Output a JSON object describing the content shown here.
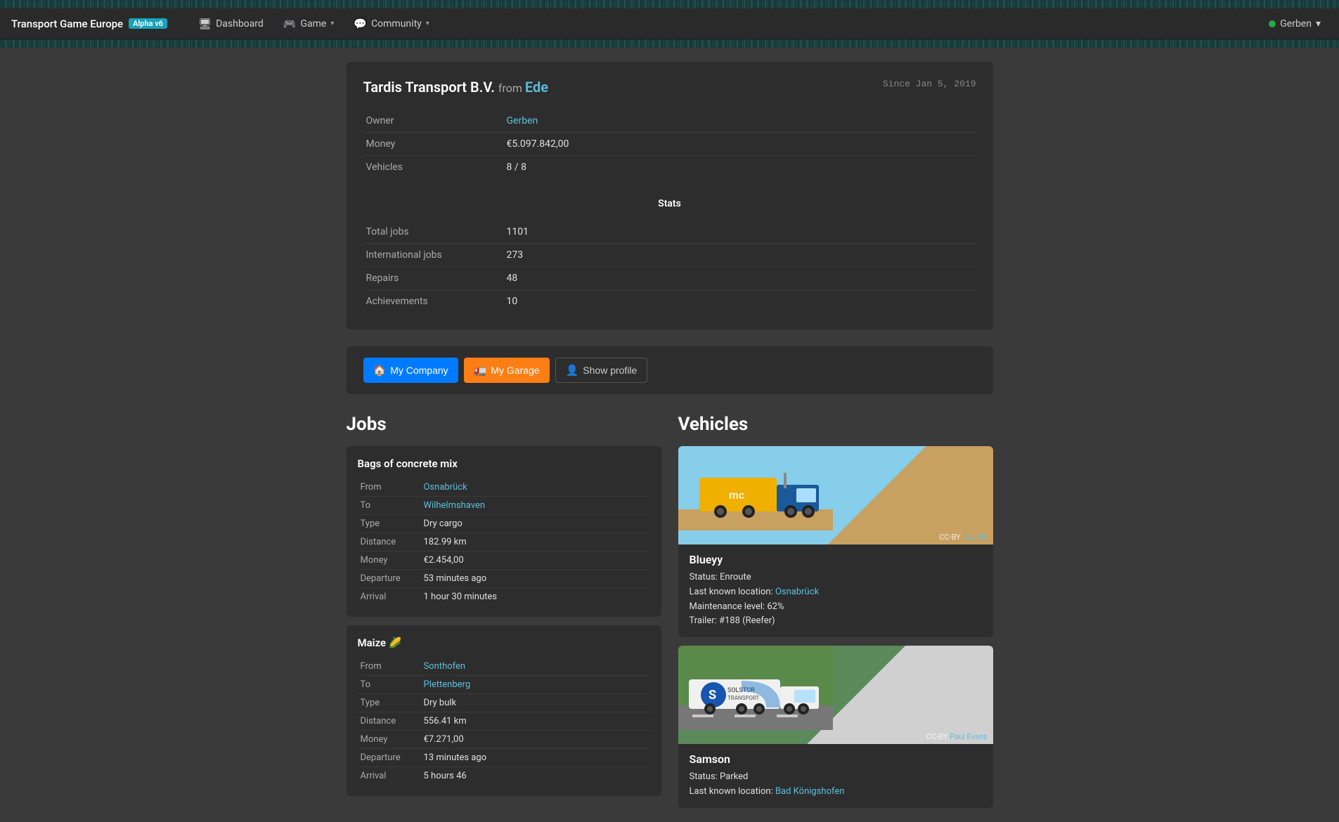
{
  "navbar": {
    "brand_title": "Transport Game Europe",
    "badge": "Alpha v6",
    "nav_items": [
      {
        "label": "Dashboard",
        "icon": "🖥",
        "has_dropdown": false
      },
      {
        "label": "Game",
        "icon": "🎮",
        "has_dropdown": true
      },
      {
        "label": "Community",
        "icon": "💬",
        "has_dropdown": true
      }
    ],
    "user": {
      "name": "Gerben",
      "status_color": "#28a745",
      "has_dropdown": true
    }
  },
  "company": {
    "name": "Tardis Transport B.V.",
    "from_label": "from",
    "city": "Ede",
    "since": "Since Jan 5, 2019",
    "owner_label": "Owner",
    "owner_value": "Gerben",
    "money_label": "Money",
    "money_value": "€5.097.842,00",
    "vehicles_label": "Vehicles",
    "vehicles_value": "8 / 8",
    "stats_heading": "Stats",
    "stats": [
      {
        "label": "Total jobs",
        "value": "1101"
      },
      {
        "label": "International jobs",
        "value": "273"
      },
      {
        "label": "Repairs",
        "value": "48"
      },
      {
        "label": "Achievements",
        "value": "10"
      }
    ]
  },
  "action_buttons": {
    "my_company": "My Company",
    "my_garage": "My Garage",
    "show_profile": "Show profile"
  },
  "jobs_section": {
    "heading": "Jobs",
    "cards": [
      {
        "title": "Bags of concrete mix",
        "emoji": "",
        "details": [
          {
            "label": "From",
            "value": "Osnabrück",
            "is_link": true
          },
          {
            "label": "To",
            "value": "Wilhelmshaven",
            "is_link": true
          },
          {
            "label": "Type",
            "value": "Dry cargo",
            "is_link": false
          },
          {
            "label": "Distance",
            "value": "182.99 km",
            "is_link": false
          },
          {
            "label": "Money",
            "value": "€2.454,00",
            "is_link": false
          },
          {
            "label": "Departure",
            "value": "53 minutes ago",
            "is_link": false
          },
          {
            "label": "Arrival",
            "value": "1 hour 30 minutes",
            "is_link": false
          }
        ]
      },
      {
        "title": "Maize 🌽",
        "emoji": "",
        "details": [
          {
            "label": "From",
            "value": "Sonthofen",
            "is_link": true
          },
          {
            "label": "To",
            "value": "Plettenberg",
            "is_link": true
          },
          {
            "label": "Type",
            "value": "Dry bulk",
            "is_link": false
          },
          {
            "label": "Distance",
            "value": "556.41 km",
            "is_link": false
          },
          {
            "label": "Money",
            "value": "€7.271,00",
            "is_link": false
          },
          {
            "label": "Departure",
            "value": "13 minutes ago",
            "is_link": false
          },
          {
            "label": "Arrival",
            "value": "5 hours 46",
            "is_link": false
          }
        ]
      }
    ]
  },
  "vehicles_section": {
    "heading": "Vehicles",
    "cards": [
      {
        "name": "Blueyy",
        "cc_text": "CC-BY",
        "cc_author": "Lav Ulv",
        "status": "Status: Enroute",
        "last_location_label": "Last known location:",
        "last_location": "Osnabrück",
        "maintenance": "Maintenance level: 62%",
        "trailer": "Trailer: #188 (Reefer)"
      },
      {
        "name": "Samson",
        "cc_text": "CC-BY",
        "cc_author": "Paul Evans",
        "status": "Status: Parked",
        "last_location_label": "Last known location:",
        "last_location": "Bad Königshofen",
        "maintenance": "",
        "trailer": ""
      }
    ]
  }
}
